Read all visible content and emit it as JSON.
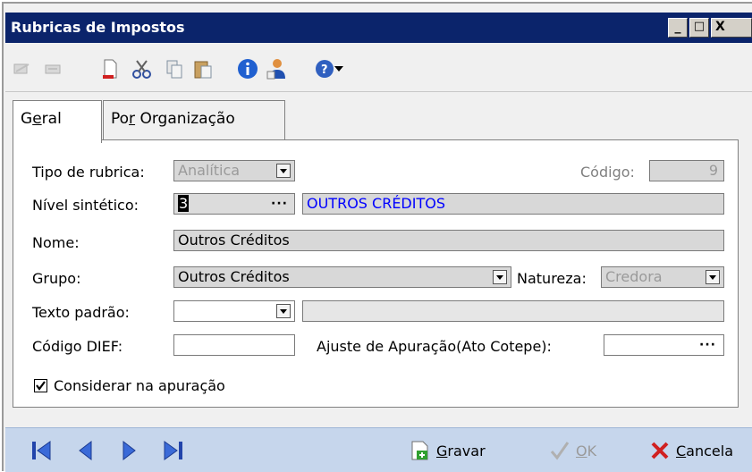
{
  "window": {
    "title": "Rubricas de Impostos",
    "min": "_",
    "max": "□",
    "close": "X"
  },
  "tabs": [
    {
      "label_pre": "G",
      "label_u": "e",
      "label_post": "ral"
    },
    {
      "label_pre": "Po",
      "label_u": "r",
      "label_post": " Organização"
    }
  ],
  "form": {
    "tipo_label": "Tipo de rubrica:",
    "tipo_value": "Analítica",
    "codigo_label": "Código:",
    "codigo_value": "9",
    "nivel_label": "Nível sintético:",
    "nivel_value": "3",
    "nivel_desc": "OUTROS CRÉDITOS",
    "nome_label": "Nome:",
    "nome_value": "Outros Créditos",
    "grupo_label": "Grupo:",
    "grupo_value": "Outros Créditos",
    "natureza_label": "Natureza:",
    "natureza_value": "Credora",
    "texto_label": "Texto padrão:",
    "texto_value": "",
    "texto_desc": "",
    "dief_label": "Código DIEF:",
    "dief_value": "",
    "ajuste_label": "Ajuste de Apuração(Ato Cotepe):",
    "ajuste_value": "",
    "considerar_label": "Considerar na apuração",
    "considerar_checked": true,
    "dots": "···"
  },
  "buttons": {
    "gravar_u": "G",
    "gravar_rest": "ravar",
    "ok_u": "O",
    "ok_rest": "K",
    "cancela_u": "C",
    "cancela_rest": "ancela"
  },
  "colors": {
    "titlebar": "#0b246b",
    "bottombar": "#c6d6ec",
    "link_blue": "#0000ff"
  }
}
